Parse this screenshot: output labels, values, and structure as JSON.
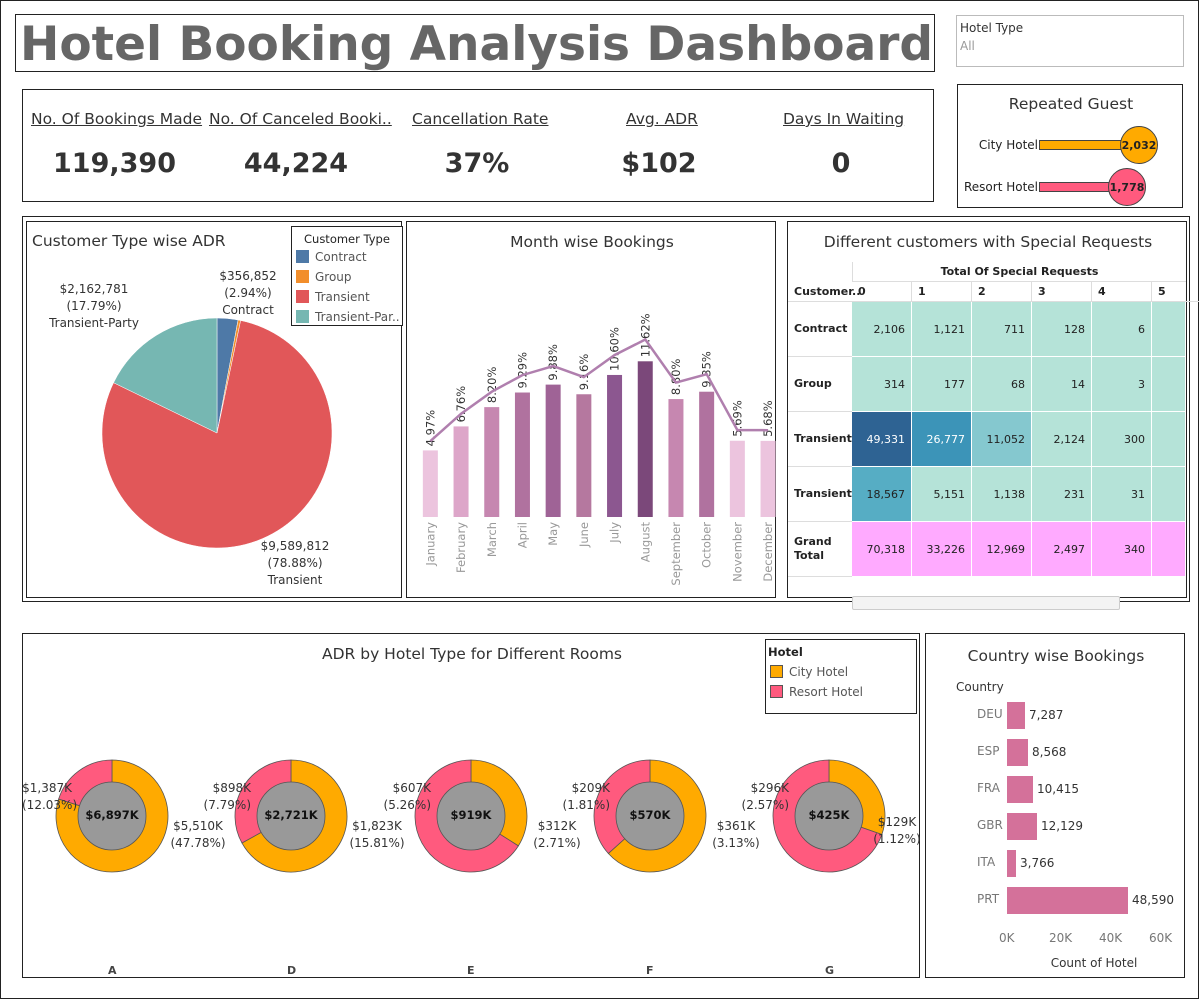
{
  "title": "Hotel Booking Analysis Dashboard",
  "filter": {
    "label": "Hotel Type",
    "value": "All"
  },
  "kpis": [
    {
      "label": "No. Of Bookings Made",
      "value": "119,390"
    },
    {
      "label": "No. Of Canceled Booki..",
      "value": "44,224"
    },
    {
      "label": "Cancellation Rate",
      "value": "37%"
    },
    {
      "label": "Avg. ADR",
      "value": "$102"
    },
    {
      "label": "Days In Waiting",
      "value": "0"
    }
  ],
  "repeated_guest": {
    "title": "Repeated Guest",
    "items": [
      {
        "label": "City Hotel",
        "value": 2032,
        "value_label": "2,032",
        "color": "#ffaa00"
      },
      {
        "label": "Resort Hotel",
        "value": 1778,
        "value_label": "1,778",
        "color": "#ff5a7e"
      }
    ]
  },
  "customer_type_adr": {
    "title": "Customer Type wise ADR",
    "legend_title": "Customer Type",
    "legend": [
      {
        "name": "Contract",
        "color": "#4e79a7"
      },
      {
        "name": "Group",
        "color": "#f28e2b"
      },
      {
        "name": "Transient",
        "color": "#e15759"
      },
      {
        "name": "Transient-Par..",
        "color": "#76b7b2"
      }
    ],
    "labels": [
      {
        "value": "$356,852",
        "pct": "(2.94%)",
        "name": "Contract"
      },
      {
        "value": "$2,162,781",
        "pct": "(17.79%)",
        "name": "Transient-Party"
      },
      {
        "value": "$9,589,812",
        "pct": "(78.88%)",
        "name": "Transient"
      }
    ]
  },
  "month_bookings": {
    "title": "Month wise Bookings"
  },
  "special_requests": {
    "title": "Different customers with Special Requests",
    "header": "Total Of Special Requests",
    "row_header": "Customer..",
    "columns": [
      "0",
      "1",
      "2",
      "3",
      "4",
      "5"
    ],
    "rows": [
      {
        "label": "Contract",
        "cells": [
          "2,106",
          "1,121",
          "711",
          "128",
          "6",
          ""
        ]
      },
      {
        "label": "Group",
        "cells": [
          "314",
          "177",
          "68",
          "14",
          "3",
          ""
        ]
      },
      {
        "label": "Transient",
        "cells": [
          "49,331",
          "26,777",
          "11,052",
          "2,124",
          "300",
          ""
        ]
      },
      {
        "label": "Transient..",
        "cells": [
          "18,567",
          "5,151",
          "1,138",
          "231",
          "31",
          ""
        ]
      },
      {
        "label": "Grand Total",
        "cells": [
          "70,318",
          "33,226",
          "12,969",
          "2,497",
          "340",
          ""
        ]
      }
    ]
  },
  "adr_rooms": {
    "title": "ADR by Hotel Type for Different Rooms",
    "legend_title": "Hotel",
    "legend": [
      {
        "name": "City Hotel",
        "color": "#ffaa00"
      },
      {
        "name": "Resort Hotel",
        "color": "#ff5a7e"
      }
    ],
    "rooms": [
      {
        "room": "A",
        "total": "$6,897K",
        "resort": "$1,387K",
        "resort_pct": "(12.03%)",
        "city": "$5,510K",
        "city_pct": "(47.78%)"
      },
      {
        "room": "D",
        "total": "$2,721K",
        "resort": "$898K",
        "resort_pct": "(7.79%)",
        "city": "$1,823K",
        "city_pct": "(15.81%)"
      },
      {
        "room": "E",
        "total": "$919K",
        "resort": "$607K",
        "resort_pct": "(5.26%)",
        "city": "$312K",
        "city_pct": "(2.71%)"
      },
      {
        "room": "F",
        "total": "$570K",
        "resort": "$209K",
        "resort_pct": "(1.81%)",
        "city": "$361K",
        "city_pct": "(3.13%)"
      },
      {
        "room": "G",
        "total": "$425K",
        "resort": "$296K",
        "resort_pct": "(2.57%)",
        "city": "$129K",
        "city_pct": "(1.12%)"
      }
    ]
  },
  "country_bookings": {
    "title": "Country wise Bookings",
    "axis_title": "Country",
    "x_title": "Count of Hotel",
    "ticks": [
      "0K",
      "20K",
      "40K",
      "60K"
    ]
  },
  "chart_data": [
    {
      "type": "pie",
      "title": "Customer Type wise ADR",
      "categories": [
        "Contract",
        "Group",
        "Transient",
        "Transient-Party"
      ],
      "values": [
        356852,
        44000,
        9589812,
        2162781
      ],
      "percent": [
        2.94,
        0.36,
        78.88,
        17.79
      ]
    },
    {
      "type": "bar",
      "title": "Month wise Bookings",
      "categories": [
        "January",
        "February",
        "March",
        "April",
        "May",
        "June",
        "July",
        "August",
        "September",
        "October",
        "November",
        "December"
      ],
      "values": [
        4.97,
        6.76,
        8.2,
        9.29,
        9.88,
        9.16,
        10.6,
        11.62,
        8.8,
        9.35,
        5.69,
        5.68
      ],
      "value_labels": [
        "4.97%",
        "6.76%",
        "8.20%",
        "9.29%",
        "9.88%",
        "9.16%",
        "10.60%",
        "11.62%",
        "8.80%",
        "9.35%",
        "5.69%",
        "5.68%"
      ],
      "line_values": [
        4.97,
        6.76,
        8.2,
        9.29,
        9.88,
        9.16,
        10.6,
        11.62,
        8.8,
        9.35,
        5.69,
        5.68
      ]
    },
    {
      "type": "bar",
      "title": "Repeated Guest",
      "categories": [
        "City Hotel",
        "Resort Hotel"
      ],
      "values": [
        2032,
        1778
      ]
    },
    {
      "type": "pie",
      "title": "ADR by Hotel Type for Different Rooms",
      "categories": [
        "A",
        "D",
        "E",
        "F",
        "G"
      ],
      "series": [
        {
          "name": "City Hotel",
          "values": [
            5510,
            1823,
            312,
            361,
            129
          ]
        },
        {
          "name": "Resort Hotel",
          "values": [
            1387,
            898,
            607,
            209,
            296
          ]
        }
      ]
    },
    {
      "type": "bar",
      "title": "Country wise Bookings",
      "categories": [
        "DEU",
        "ESP",
        "FRA",
        "GBR",
        "ITA",
        "PRT"
      ],
      "values": [
        7287,
        8568,
        10415,
        12129,
        3766,
        48590
      ],
      "value_labels": [
        "7,287",
        "8,568",
        "10,415",
        "12,129",
        "3,766",
        "48,590"
      ],
      "xlim": [
        0,
        60000
      ]
    }
  ]
}
